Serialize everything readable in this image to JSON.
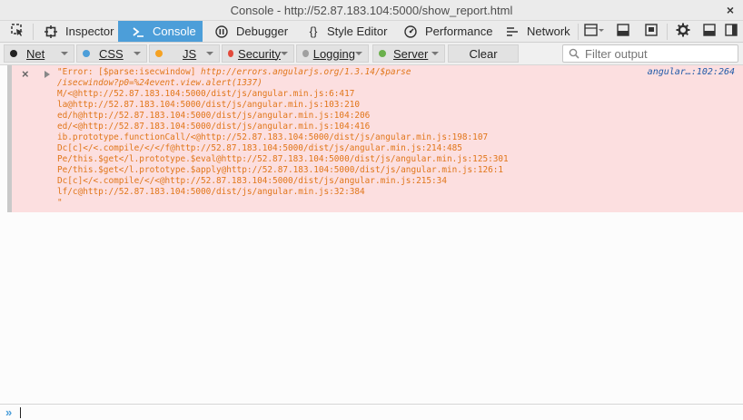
{
  "window": {
    "title": "Console - http://52.87.183.104:5000/show_report.html",
    "close_glyph": "×"
  },
  "toolbar": {
    "tabs": [
      {
        "label": "Inspector",
        "icon": "inspector-icon"
      },
      {
        "label": "Console",
        "icon": "console-icon",
        "active": true
      },
      {
        "label": "Debugger",
        "icon": "debugger-icon"
      },
      {
        "label": "Style Editor",
        "icon": "style-editor-icon"
      },
      {
        "label": "Performance",
        "icon": "performance-icon"
      },
      {
        "label": "Network",
        "icon": "network-icon"
      }
    ],
    "right_icons": [
      "responsive-design-icon",
      "scratchpad-icon",
      "screenshot-icon",
      "settings-icon",
      "dock-bottom-icon",
      "dock-side-icon"
    ],
    "accent": "#4c9ed9"
  },
  "filters": {
    "items": [
      {
        "label": "Net",
        "color": "#222222"
      },
      {
        "label": "CSS",
        "color": "#4c9ed9"
      },
      {
        "label": "JS",
        "color": "#f5a223"
      },
      {
        "label": "Security",
        "color": "#e24a3b"
      },
      {
        "label": "Logging",
        "color": "#a0a0a0"
      },
      {
        "label": "Server",
        "color": "#6ab04c"
      }
    ],
    "clear_label": "Clear",
    "search_placeholder": "Filter output"
  },
  "message": {
    "close_glyph": "×",
    "prefix": "\"Error: [$parse:isecwindow] ",
    "link_line1": "http://errors.angularjs.org/1.3.14/$parse",
    "link_line2": "/isecwindow?p0=%24event.view.alert(1337)",
    "stack": [
      "M/<@http://52.87.183.104:5000/dist/js/angular.min.js:6:417",
      "la@http://52.87.183.104:5000/dist/js/angular.min.js:103:210",
      "ed/h@http://52.87.183.104:5000/dist/js/angular.min.js:104:206",
      "ed/<@http://52.87.183.104:5000/dist/js/angular.min.js:104:416",
      "ib.prototype.functionCall/<@http://52.87.183.104:5000/dist/js/angular.min.js:198:107",
      "Dc[c]</<.compile/</</f@http://52.87.183.104:5000/dist/js/angular.min.js:214:485",
      "Pe/this.$get</l.prototype.$eval@http://52.87.183.104:5000/dist/js/angular.min.js:125:301",
      "Pe/this.$get</l.prototype.$apply@http://52.87.183.104:5000/dist/js/angular.min.js:126:1",
      "Dc[c]</<.compile/</<@http://52.87.183.104:5000/dist/js/angular.min.js:215:34",
      "lf/c@http://52.87.183.104:5000/dist/js/angular.min.js:32:384",
      "\""
    ],
    "location": "angular…:102:264",
    "bg_color": "#fcdfe0",
    "text_color": "#e1761a"
  },
  "input": {
    "prompt": "»"
  }
}
